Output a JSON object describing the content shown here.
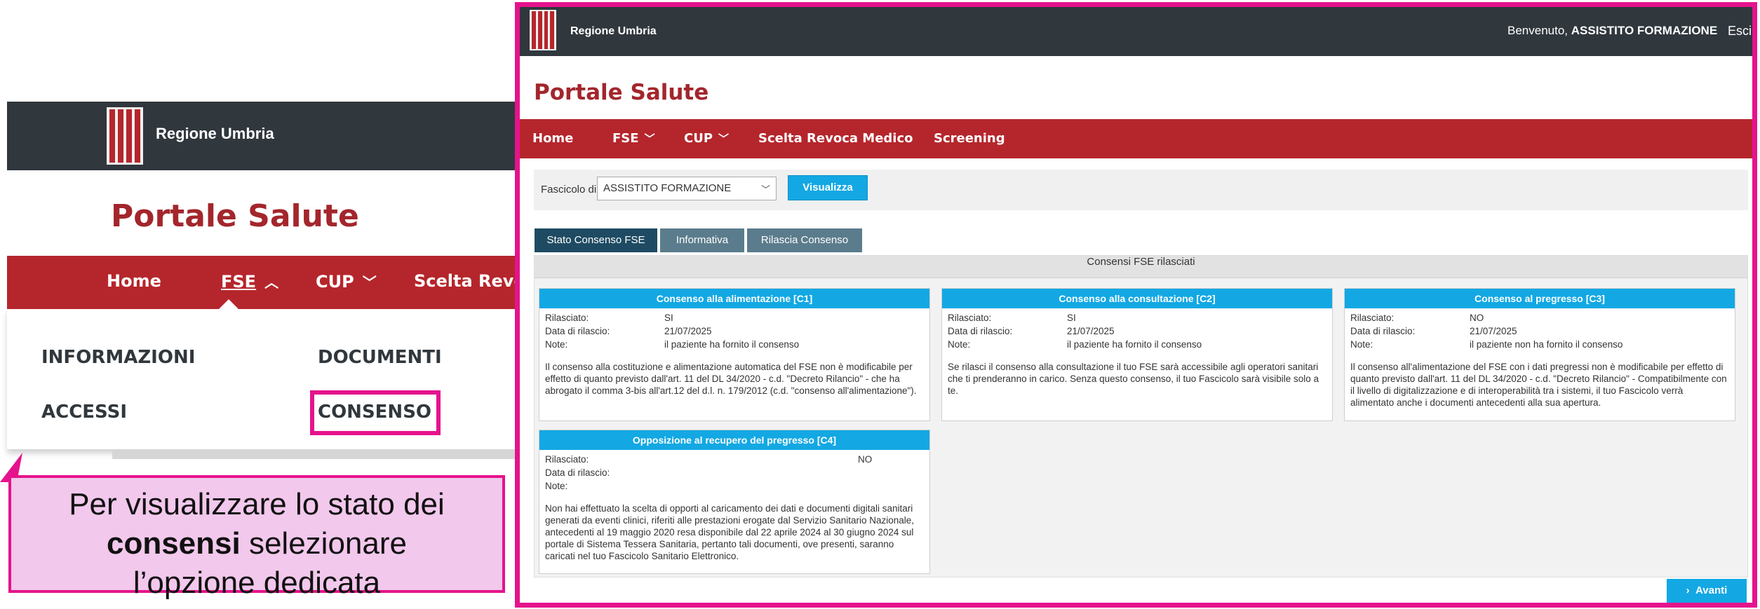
{
  "left": {
    "brand": "Regione Umbria",
    "title": "Portale Salute",
    "nav": {
      "home": "Home",
      "fse": "FSE",
      "cup": "CUP",
      "scelta": "Scelta Revoc"
    },
    "dropdown": {
      "informazioni": "INFORMAZIONI",
      "documenti": "DOCUMENTI",
      "accessi": "ACCESSI",
      "consenso": "CONSENSO"
    }
  },
  "callout": {
    "line1": "Per visualizzare lo stato dei",
    "line2_bold": "consensi",
    "line2_rest": " selezionare",
    "line3": "l’opzione dedicata"
  },
  "right": {
    "brand": "Regione Umbria",
    "welcome_prefix": "Benvenuto, ",
    "welcome_user": "ASSISTITO FORMAZIONE",
    "logout": "Esci",
    "title": "Portale Salute",
    "nav": {
      "home": "Home",
      "fse": "FSE",
      "cup": "CUP",
      "scelta": "Scelta Revoca Medico",
      "screening": "Screening"
    },
    "fascicolo": {
      "label": "Fascicolo di",
      "selected": "ASSISTITO FORMAZIONE",
      "button": "Visualizza"
    },
    "tabs": {
      "stato": "Stato Consenso FSE",
      "info": "Informativa",
      "rilascia": "Rilascia Consenso"
    },
    "section_title": "Consensi FSE rilasciati",
    "labels": {
      "rilasciato": "Rilasciato:",
      "data": "Data di rilascio:",
      "note": "Note:"
    },
    "cards": [
      {
        "title": "Consenso alla alimentazione [C1]",
        "rilasciato": "SI",
        "data": "21/07/2025",
        "note": "il paziente ha fornito il consenso",
        "text": "Il consenso alla costituzione e alimentazione automatica del FSE non è modificabile per effetto di quanto previsto dall'art. 11 del DL 34/2020 - c.d. \"Decreto Rilancio\" - che ha abrogato il comma 3-bis all'art.12 del d.l. n. 179/2012 (c.d. \"consenso all'alimentazione\")."
      },
      {
        "title": "Consenso alla consultazione [C2]",
        "rilasciato": "SI",
        "data": "21/07/2025",
        "note": "il paziente ha fornito il consenso",
        "text": "Se rilasci il consenso alla consultazione il tuo FSE sarà accessibile agli operatori sanitari che ti prenderanno in carico. Senza questo consenso, il tuo Fascicolo sarà visibile solo a te."
      },
      {
        "title": "Consenso al pregresso [C3]",
        "rilasciato": "NO",
        "data": "21/07/2025",
        "note": "il paziente non ha fornito il consenso",
        "text": "Il consenso all'alimentazione del FSE con i dati pregressi non è modificabile per effetto di quanto previsto dall'art. 11 del DL 34/2020 - c.d. \"Decreto Rilancio\" - Compatibilmente con il livello di digitalizzazione e di interoperabilità tra i sistemi, il tuo Fascicolo verrà alimentato anche i documenti antecedenti alla sua apertura."
      },
      {
        "title": "Opposizione al recupero del pregresso [C4]",
        "rilasciato": "NO",
        "data": "",
        "note": "",
        "text": "Non hai effettuato la scelta di opporti al caricamento dei dati e documenti digitali sanitari generati da eventi clinici, riferiti alle prestazioni erogate dal Servizio Sanitario Nazionale, antecedenti al 19 maggio 2020 resa disponibile dal 22 aprile 2024 al 30 giugno 2024 sul portale di Sistema Tessera Sanitaria, pertanto tali documenti, ove presenti, saranno caricati nel tuo Fascicolo Sanitario Elettronico."
      }
    ],
    "next_button": "Avanti"
  },
  "icons": {
    "logo": "regione-umbria-logo",
    "chevron_down": "chevron-down-icon",
    "chevron_up": "chevron-up-icon",
    "chevron_right": "chevron-right-icon"
  },
  "colors": {
    "header": "#30373d",
    "nav": "#b5262c",
    "title": "#a3262c",
    "accent": "#13a8e3",
    "highlight": "#e5138c",
    "callout_bg": "#f2c8ec"
  }
}
